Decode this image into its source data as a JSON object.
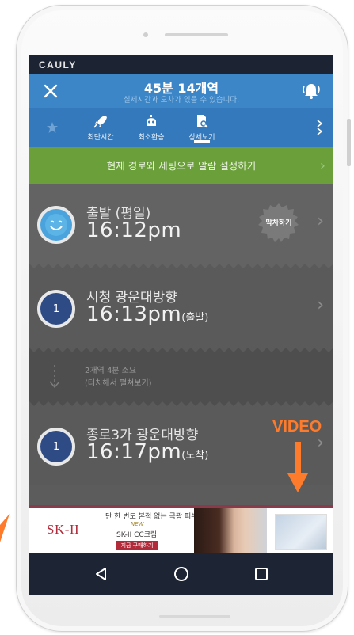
{
  "brand": "CAULY",
  "header": {
    "title": "45분 14개역",
    "subtitle": "실제시간과 오차가 있을 수 있습니다."
  },
  "tabs": [
    {
      "label": "최단시간",
      "icon": "rocket-icon"
    },
    {
      "label": "최소환승",
      "icon": "robot-icon"
    },
    {
      "label": "상세보기",
      "icon": "document-search-icon",
      "active": true
    }
  ],
  "alarm_bar": {
    "label": "현재 경로와 세팅으로 알람 설정하기"
  },
  "departure": {
    "title": "출발 (평일)",
    "time": "16:12pm",
    "stamp": "막차하기"
  },
  "stop1": {
    "number": "1",
    "name": "시청 광운대방향",
    "time": "16:13pm",
    "suffix": "(출발)"
  },
  "transit": {
    "line1": "2개역 4분 소요",
    "line2": "(터치해서 펼쳐보기)"
  },
  "stop2": {
    "number": "1",
    "name": "종로3가 광운대방향",
    "time": "16:17pm",
    "suffix": "(도착)"
  },
  "ad": {
    "brand": "SK-II",
    "headline": "단 한 번도 본적 없는 극광 피부",
    "tag": "NEW",
    "product": "SK-II CC크림",
    "cta": "지금 구매하기"
  },
  "overlay": {
    "label": "VIDEO"
  },
  "colors": {
    "header_blue": "#3c85c6",
    "alarm_green": "#6a9f3a",
    "accent_orange": "#ff7b2c",
    "nav_dark": "#1d2434"
  }
}
